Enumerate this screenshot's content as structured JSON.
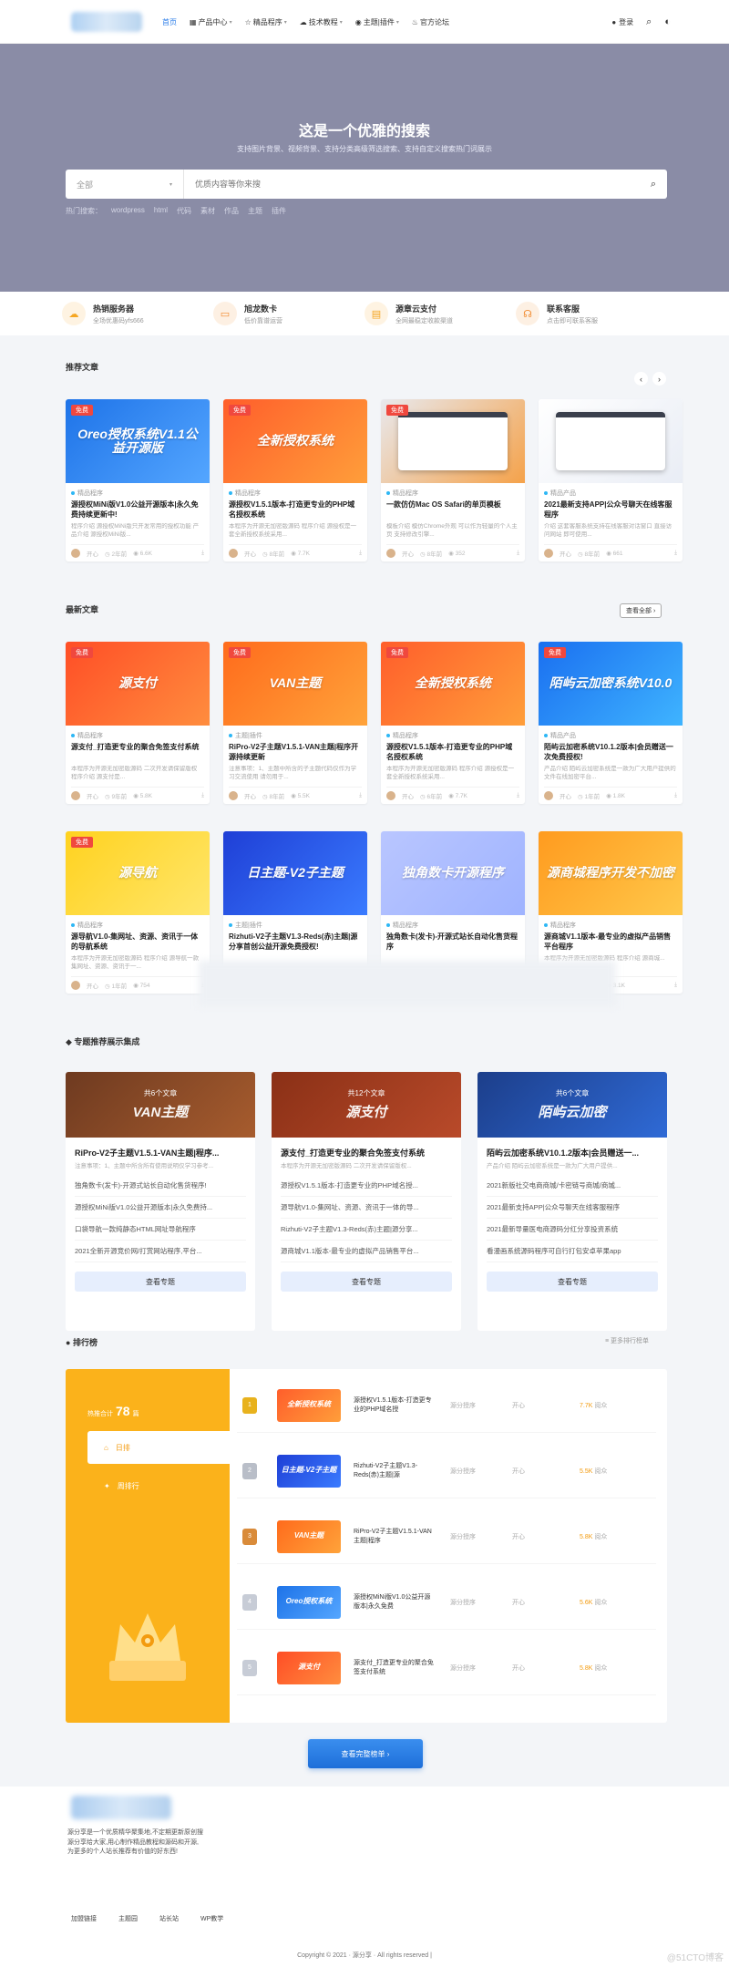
{
  "nav": {
    "items": [
      {
        "label": "首页"
      },
      {
        "label": "产品中心"
      },
      {
        "label": "精品程序"
      },
      {
        "label": "技术教程"
      },
      {
        "label": "主题|插件"
      },
      {
        "label": "官方论坛"
      }
    ],
    "login": "登录"
  },
  "hero": {
    "title": "这是一个优雅的搜索",
    "subtitle": "支持图片背景、视频背景、支持分类高级筛选搜索、支持自定义搜索热门词展示",
    "category": "全部",
    "placeholder": "优质内容等你来搜",
    "hot_label": "热门搜索：",
    "hot_words": [
      "wordpress",
      "html",
      "代码",
      "素材",
      "作品",
      "主题",
      "插件"
    ]
  },
  "features": [
    {
      "title": "热销服务器",
      "sub": "全场优惠码yfs666",
      "icon": "cloud-icon",
      "color": "#f5a623"
    },
    {
      "title": "旭龙数卡",
      "sub": "低价靠谱运营",
      "icon": "card-icon",
      "color": "#f28b30"
    },
    {
      "title": "源章云支付",
      "sub": "全网最稳定收款渠道",
      "icon": "wallet-icon",
      "color": "#f5a623"
    },
    {
      "title": "联系客服",
      "sub": "点击即可联系客服",
      "icon": "headset-icon",
      "color": "#f28b30"
    }
  ],
  "recommend": {
    "title": "推荐文章",
    "cards": [
      {
        "badge": "免费",
        "thumb": "Oreo授权系统V1.1公益开源版",
        "c1": "#1e73e8",
        "c2": "#54a6ff",
        "cat": "精品程序",
        "title": "源授权MiNi版V1.0公益开源版本|永久免费持续更新中!",
        "desc": "程序介绍 源授权MiNi版只开发常用的授权功能 产品介绍 源授权MiNi版...",
        "author": "开心",
        "time": "2年前",
        "views": "6.6K"
      },
      {
        "badge": "免费",
        "thumb": "全新授权系统",
        "c1": "#ff5e2b",
        "c2": "#ff9e3a",
        "cat": "精品程序",
        "title": "源授权V1.5.1版本-打造更专业的PHP域名授权系统",
        "desc": "本程序为开源无加密版源码 程序介绍 源授权是一套全新授权系统采用...",
        "author": "开心",
        "time": "8年前",
        "views": "7.7K"
      },
      {
        "badge": "免费",
        "thumb": "",
        "c1": "#e8e9ee",
        "c2": "#f5a24a",
        "cat": "精品程序",
        "title": "一款仿仿Mac OS Safari的单页模板",
        "desc": "模板介绍 模仿Chrome外观 可以作为轻量的个人主页 支持修改引擎...",
        "author": "开心",
        "time": "8年前",
        "views": "352"
      },
      {
        "badge": "",
        "thumb": "",
        "c1": "#ffffff",
        "c2": "#e9edf5",
        "cat": "精品产品",
        "title": "2021最新支持APP|公众号聊天在线客服程序",
        "desc": "介绍 这套客服系统支持在线客服对话窗口 直接访问网站 即可使用...",
        "author": "开心",
        "time": "8年前",
        "views": "661"
      }
    ]
  },
  "latest": {
    "title": "最新文章",
    "view_all": "查看全部",
    "cards": [
      {
        "badge": "免费",
        "thumb": "源支付",
        "c1": "#ff4e26",
        "c2": "#ff8d3e",
        "cat": "精品程序",
        "title": "源支付_打造更专业的聚合免签支付系统",
        "desc": "本程序为开源无加密版源码 二次开发请保留版权 程序介绍 源支付是...",
        "author": "开心",
        "time": "9年前",
        "views": "5.8K"
      },
      {
        "badge": "免费",
        "thumb": "VAN主题",
        "c1": "#ff6b1c",
        "c2": "#ffa33a",
        "cat": "主题|插件",
        "title": "RiPro-V2子主题V1.5.1-VAN主题|程序开源持续更新",
        "desc": "注意事项：1、主题中所含的子主题代码仅作为学习交流使用 请勿用于...",
        "author": "开心",
        "time": "8年前",
        "views": "5.5K"
      },
      {
        "badge": "免费",
        "thumb": "全新授权系统",
        "c1": "#ff5e2b",
        "c2": "#ff9e3a",
        "cat": "精品程序",
        "title": "源授权V1.5.1版本-打造更专业的PHP域名授权系统",
        "desc": "本程序为开源无加密版源码 程序介绍 源授权是一套全新授权系统采用...",
        "author": "开心",
        "time": "6年前",
        "views": "7.7K"
      },
      {
        "badge": "免费",
        "thumb": "陌屿云加密系统V10.0",
        "c1": "#1a6ff0",
        "c2": "#3fb4ff",
        "cat": "精品产品",
        "title": "陌屿云加密系统V10.1.2版本|会员赠送一次免费授权!",
        "desc": "产品介绍 陌屿云加密系统是一款为广大用户提供的文件在线加密平台...",
        "author": "开心",
        "time": "1年前",
        "views": "1.8K"
      },
      {
        "badge": "免费",
        "thumb": "源导航",
        "c1": "#ffd21f",
        "c2": "#ffe66b",
        "cat": "精品程序",
        "title": "源导航V1.0-集网址、资源、资讯于一体的导航系统",
        "desc": "本程序为开源无加密版源码 程序介绍 源导航一款集网址、资源、资讯于一...",
        "author": "开心",
        "time": "1年前",
        "views": "754"
      },
      {
        "badge": "",
        "thumb": "日主题-V2子主题",
        "c1": "#1f3fd6",
        "c2": "#3a7bff",
        "cat": "主题|插件",
        "title": "Rizhuti-V2子主题V1.3-Reds(赤)主题|源分享首创公益开源免费授权!",
        "desc": "",
        "author": "开心",
        "time": "",
        "views": ""
      },
      {
        "badge": "",
        "thumb": "独角数卡开源程序",
        "c1": "#b9c6ff",
        "c2": "#9fb3ff",
        "cat": "精品程序",
        "title": "独角数卡(发卡)-开源式站长自动化售货程序",
        "desc": "",
        "author": "开心",
        "time": "",
        "views": ""
      },
      {
        "badge": "",
        "thumb": "源商城程序开发不加密",
        "c1": "#ff9b1f",
        "c2": "#ffc84a",
        "cat": "精品程序",
        "title": "源商城V1.1版本-最专业的虚拟产品销售平台程序",
        "desc": "本程序为开源无加密版源码 程序介绍 源商城...",
        "author": "开心",
        "time": "1年前",
        "views": "3.1K"
      }
    ]
  },
  "topics": {
    "title": "专题推荐展示集成",
    "items": [
      {
        "count": "共6个文章",
        "big": "VAN主题",
        "c1": "#6e3a20",
        "c2": "#a75c2e",
        "name": "RiPro-V2子主题V1.5.1-VAN主题|程序...",
        "sub": "注意事项：1、主题中所含所有使用说明仅学习参考...",
        "list": [
          "独角数卡(发卡)-开源式站长自动化售货程序!",
          "源授权MiNi版V1.0公益开源版本|永久免费持...",
          "口袋导航一款纯静态HTML网址导航程序",
          "2021全新开源竞价网/打赏网站程序,平台..."
        ],
        "btn": "查看专题"
      },
      {
        "count": "共12个文章",
        "big": "源支付",
        "c1": "#8a3016",
        "c2": "#b94a2a",
        "name": "源支付_打造更专业的聚合免签支付系统",
        "sub": "本程序为开源无加密版源码 二次开发请保留版权...",
        "list": [
          "源授权V1.5.1版本-打造更专业的PHP域名授...",
          "源导航V1.0-集网址、资源、资讯于一体的导...",
          "Rizhuti-V2子主题V1.3-Reds(赤)主题|源分享...",
          "源商城V1.1版本-最专业的虚拟产品销售平台..."
        ],
        "btn": "查看专题"
      },
      {
        "count": "共6个文章",
        "big": "陌屿云加密",
        "c1": "#1c3e8a",
        "c2": "#2f6ad6",
        "name": "陌屿云加密系统V10.1.2版本|会员赠送一...",
        "sub": "产品介绍 陌屿云加密系统是一款为广大用户提供...",
        "list": [
          "2021新版社交电商商城/卡密链号商城/商城...",
          "2021最新支持APP|公众号聊天在线客服程序",
          "2021最新导量医电商源码分红分享投资系统",
          "看漫画系统源码程序可自行打包安卓苹果app"
        ],
        "btn": "查看专题"
      }
    ]
  },
  "ranking": {
    "title": "排行榜",
    "more": "更多排行榜单",
    "total_label": "热推合计",
    "total_num": "78",
    "total_unit": "篇",
    "tabs": [
      "日排",
      "周排行"
    ],
    "rows": [
      {
        "rank": "1",
        "medal": "#e8b21d",
        "thumb": "全新授权系统",
        "c1": "#ff5e2b",
        "c2": "#ff9e3a",
        "title": "源授权V1.5.1版本-打造更专业的PHP域名授",
        "cat": "源分授序",
        "author": "开心",
        "views": "7.7K",
        "unit": "阅众"
      },
      {
        "rank": "2",
        "medal": "#b9bec8",
        "thumb": "日主题-V2子主题",
        "c1": "#1f3fd6",
        "c2": "#3a7bff",
        "title": "Rizhuti-V2子主题V1.3-Reds(赤)主题|源",
        "cat": "源分授序",
        "author": "开心",
        "views": "5.5K",
        "unit": "阅众"
      },
      {
        "rank": "3",
        "medal": "#d98b3a",
        "thumb": "VAN主题",
        "c1": "#ff6b1c",
        "c2": "#ffa33a",
        "title": "RiPro-V2子主题V1.5.1-VAN主题|程序",
        "cat": "源分授序",
        "author": "开心",
        "views": "5.8K",
        "unit": "阅众"
      },
      {
        "rank": "4",
        "medal": "#c7ccd6",
        "thumb": "Oreo授权系统",
        "c1": "#1e73e8",
        "c2": "#54a6ff",
        "title": "源授权MiNi版V1.0公益开源版本|永久免费",
        "cat": "源分授序",
        "author": "开心",
        "views": "5.6K",
        "unit": "阅众"
      },
      {
        "rank": "5",
        "medal": "#c7ccd6",
        "thumb": "源支付",
        "c1": "#ff4e26",
        "c2": "#ff8d3e",
        "title": "源支付_打造更专业的聚合免签支付系统",
        "cat": "源分授序",
        "author": "开心",
        "views": "5.8K",
        "unit": "阅众"
      }
    ],
    "button": "查看完整榜单"
  },
  "footer": {
    "desc": "源分享是一个优质精华聚集地,不定期更新原创搜源分享给大家,用心制作精品教程和源码和开源,为更多的个人站长推荐有价值的好东西!",
    "links": [
      "加盟链接",
      "主题园",
      "站长站",
      "WP教学"
    ],
    "copyright": "Copyright © 2021 · 源分享 · All rights reserved |",
    "watermark": "@51CTO博客"
  }
}
